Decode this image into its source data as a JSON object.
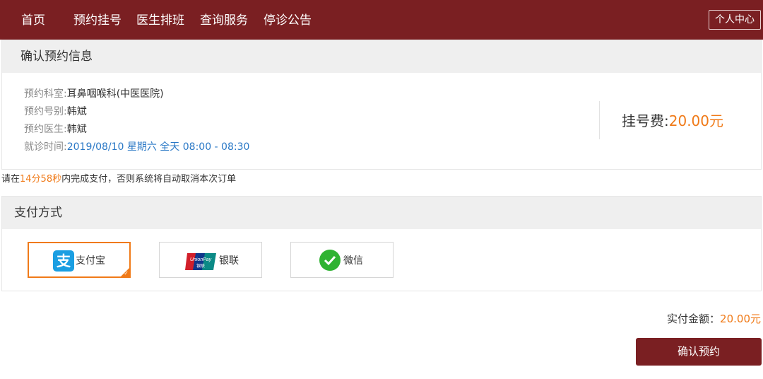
{
  "nav": {
    "items": [
      {
        "label": "首页"
      },
      {
        "label": "预约挂号"
      },
      {
        "label": "医生排班"
      },
      {
        "label": "查询服务"
      },
      {
        "label": "停诊公告"
      }
    ],
    "user_center": "个人中心"
  },
  "confirm": {
    "title": "确认预约信息",
    "department_label": "预约科室:",
    "department_value": "耳鼻咽喉科(中医医院)",
    "type_label": "预约号别:",
    "type_value": "韩斌",
    "doctor_label": "预约医生:",
    "doctor_value": "韩斌",
    "time_label": "就诊时间:",
    "time_value": "2019/08/10 星期六 全天 08:00 - 08:30",
    "fee_label": "挂号费:",
    "fee_value": "20.00元"
  },
  "notice": {
    "prefix": "请在",
    "timer": "14分58秒",
    "suffix": "内完成支付，否则系统将自动取消本次订单"
  },
  "payment": {
    "title": "支付方式",
    "options": [
      {
        "label": "支付宝",
        "icon": "alipay-icon",
        "selected": true
      },
      {
        "label": "银联",
        "icon": "unionpay-icon",
        "selected": false
      },
      {
        "label": "微信",
        "icon": "wechat-icon",
        "selected": false
      }
    ],
    "alipay_glyph": "支",
    "unionpay_text": "UnionPay",
    "unionpay_sub": "银联"
  },
  "total": {
    "label": "实付金额：",
    "value": "20.00元"
  },
  "confirm_button": "确认预约",
  "colors": {
    "brand": "#7a1f22",
    "accent": "#f07a18",
    "link": "#2a78c6"
  }
}
